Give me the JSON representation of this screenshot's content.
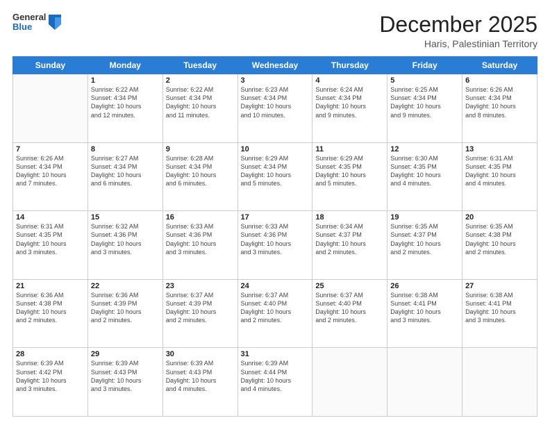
{
  "logo": {
    "general": "General",
    "blue": "Blue"
  },
  "header": {
    "month": "December 2025",
    "location": "Haris, Palestinian Territory"
  },
  "days_of_week": [
    "Sunday",
    "Monday",
    "Tuesday",
    "Wednesday",
    "Thursday",
    "Friday",
    "Saturday"
  ],
  "weeks": [
    [
      {
        "day": "",
        "info": ""
      },
      {
        "day": "1",
        "info": "Sunrise: 6:22 AM\nSunset: 4:34 PM\nDaylight: 10 hours\nand 12 minutes."
      },
      {
        "day": "2",
        "info": "Sunrise: 6:22 AM\nSunset: 4:34 PM\nDaylight: 10 hours\nand 11 minutes."
      },
      {
        "day": "3",
        "info": "Sunrise: 6:23 AM\nSunset: 4:34 PM\nDaylight: 10 hours\nand 10 minutes."
      },
      {
        "day": "4",
        "info": "Sunrise: 6:24 AM\nSunset: 4:34 PM\nDaylight: 10 hours\nand 9 minutes."
      },
      {
        "day": "5",
        "info": "Sunrise: 6:25 AM\nSunset: 4:34 PM\nDaylight: 10 hours\nand 9 minutes."
      },
      {
        "day": "6",
        "info": "Sunrise: 6:26 AM\nSunset: 4:34 PM\nDaylight: 10 hours\nand 8 minutes."
      }
    ],
    [
      {
        "day": "7",
        "info": "Sunrise: 6:26 AM\nSunset: 4:34 PM\nDaylight: 10 hours\nand 7 minutes."
      },
      {
        "day": "8",
        "info": "Sunrise: 6:27 AM\nSunset: 4:34 PM\nDaylight: 10 hours\nand 6 minutes."
      },
      {
        "day": "9",
        "info": "Sunrise: 6:28 AM\nSunset: 4:34 PM\nDaylight: 10 hours\nand 6 minutes."
      },
      {
        "day": "10",
        "info": "Sunrise: 6:29 AM\nSunset: 4:34 PM\nDaylight: 10 hours\nand 5 minutes."
      },
      {
        "day": "11",
        "info": "Sunrise: 6:29 AM\nSunset: 4:35 PM\nDaylight: 10 hours\nand 5 minutes."
      },
      {
        "day": "12",
        "info": "Sunrise: 6:30 AM\nSunset: 4:35 PM\nDaylight: 10 hours\nand 4 minutes."
      },
      {
        "day": "13",
        "info": "Sunrise: 6:31 AM\nSunset: 4:35 PM\nDaylight: 10 hours\nand 4 minutes."
      }
    ],
    [
      {
        "day": "14",
        "info": "Sunrise: 6:31 AM\nSunset: 4:35 PM\nDaylight: 10 hours\nand 3 minutes."
      },
      {
        "day": "15",
        "info": "Sunrise: 6:32 AM\nSunset: 4:36 PM\nDaylight: 10 hours\nand 3 minutes."
      },
      {
        "day": "16",
        "info": "Sunrise: 6:33 AM\nSunset: 4:36 PM\nDaylight: 10 hours\nand 3 minutes."
      },
      {
        "day": "17",
        "info": "Sunrise: 6:33 AM\nSunset: 4:36 PM\nDaylight: 10 hours\nand 3 minutes."
      },
      {
        "day": "18",
        "info": "Sunrise: 6:34 AM\nSunset: 4:37 PM\nDaylight: 10 hours\nand 2 minutes."
      },
      {
        "day": "19",
        "info": "Sunrise: 6:35 AM\nSunset: 4:37 PM\nDaylight: 10 hours\nand 2 minutes."
      },
      {
        "day": "20",
        "info": "Sunrise: 6:35 AM\nSunset: 4:38 PM\nDaylight: 10 hours\nand 2 minutes."
      }
    ],
    [
      {
        "day": "21",
        "info": "Sunrise: 6:36 AM\nSunset: 4:38 PM\nDaylight: 10 hours\nand 2 minutes."
      },
      {
        "day": "22",
        "info": "Sunrise: 6:36 AM\nSunset: 4:39 PM\nDaylight: 10 hours\nand 2 minutes."
      },
      {
        "day": "23",
        "info": "Sunrise: 6:37 AM\nSunset: 4:39 PM\nDaylight: 10 hours\nand 2 minutes."
      },
      {
        "day": "24",
        "info": "Sunrise: 6:37 AM\nSunset: 4:40 PM\nDaylight: 10 hours\nand 2 minutes."
      },
      {
        "day": "25",
        "info": "Sunrise: 6:37 AM\nSunset: 4:40 PM\nDaylight: 10 hours\nand 2 minutes."
      },
      {
        "day": "26",
        "info": "Sunrise: 6:38 AM\nSunset: 4:41 PM\nDaylight: 10 hours\nand 3 minutes."
      },
      {
        "day": "27",
        "info": "Sunrise: 6:38 AM\nSunset: 4:41 PM\nDaylight: 10 hours\nand 3 minutes."
      }
    ],
    [
      {
        "day": "28",
        "info": "Sunrise: 6:39 AM\nSunset: 4:42 PM\nDaylight: 10 hours\nand 3 minutes."
      },
      {
        "day": "29",
        "info": "Sunrise: 6:39 AM\nSunset: 4:43 PM\nDaylight: 10 hours\nand 3 minutes."
      },
      {
        "day": "30",
        "info": "Sunrise: 6:39 AM\nSunset: 4:43 PM\nDaylight: 10 hours\nand 4 minutes."
      },
      {
        "day": "31",
        "info": "Sunrise: 6:39 AM\nSunset: 4:44 PM\nDaylight: 10 hours\nand 4 minutes."
      },
      {
        "day": "",
        "info": ""
      },
      {
        "day": "",
        "info": ""
      },
      {
        "day": "",
        "info": ""
      }
    ]
  ]
}
